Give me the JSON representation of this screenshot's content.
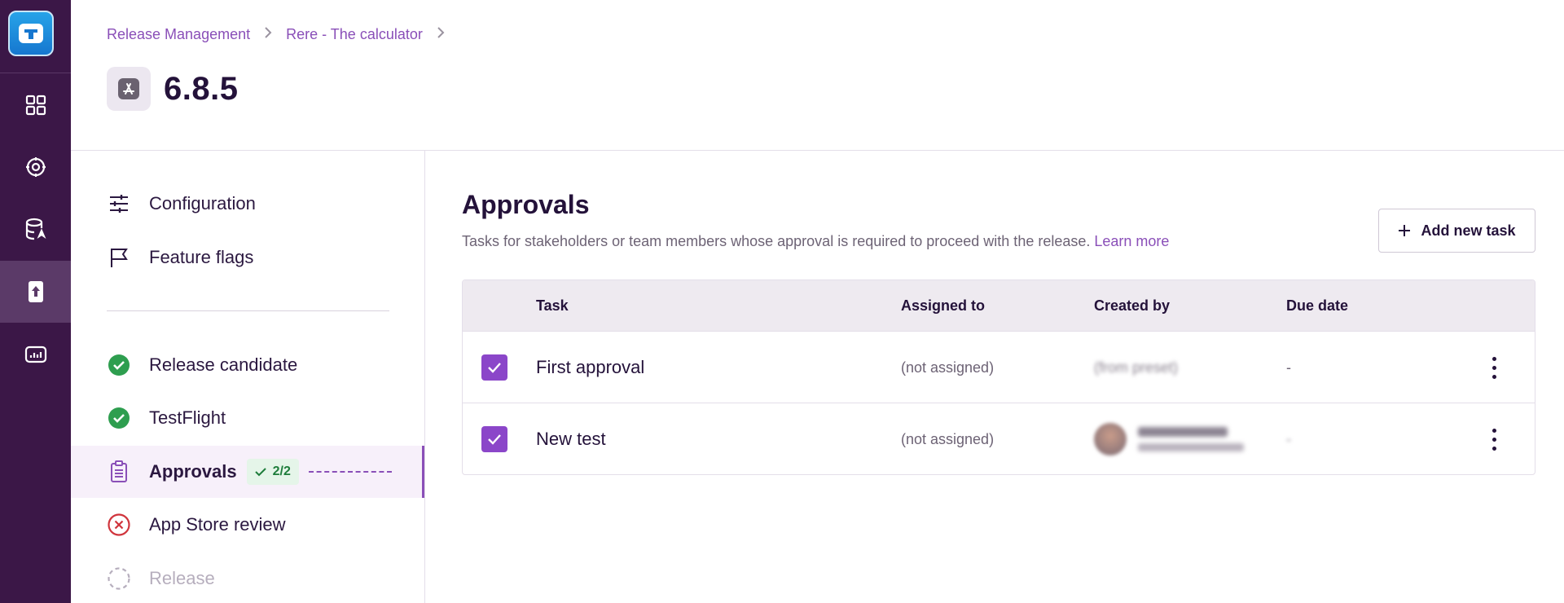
{
  "breadcrumb": {
    "items": [
      "Release Management",
      "Rere - The calculator"
    ]
  },
  "page": {
    "title": "6.8.5"
  },
  "steps_sidebar": {
    "top_items": [
      {
        "label": "Configuration",
        "icon": "sliders-icon"
      },
      {
        "label": "Feature flags",
        "icon": "flag-icon"
      }
    ],
    "steps": [
      {
        "label": "Release candidate",
        "status": "done"
      },
      {
        "label": "TestFlight",
        "status": "done"
      },
      {
        "label": "Approvals",
        "status": "active",
        "badge": "2/2"
      },
      {
        "label": "App Store review",
        "status": "failed"
      },
      {
        "label": "Release",
        "status": "pending"
      }
    ]
  },
  "approvals": {
    "title": "Approvals",
    "description": "Tasks for stakeholders or team members whose approval is required to proceed with the release.",
    "learn_more": "Learn more",
    "add_button": "Add new task",
    "columns": [
      "Task",
      "Assigned to",
      "Created by",
      "Due date"
    ],
    "rows": [
      {
        "checked": true,
        "task": "First approval",
        "assigned_to": "(not assigned)",
        "created_by": "(from preset)",
        "due_date": "-"
      },
      {
        "checked": true,
        "task": "New test",
        "assigned_to": "(not assigned)",
        "created_by": "",
        "due_date": "-"
      }
    ]
  },
  "colors": {
    "rail": "#3b1747",
    "accent": "#8a4fb8",
    "checkbox": "#8b46c9",
    "success": "#2e9e4f",
    "error": "#d0343c"
  }
}
